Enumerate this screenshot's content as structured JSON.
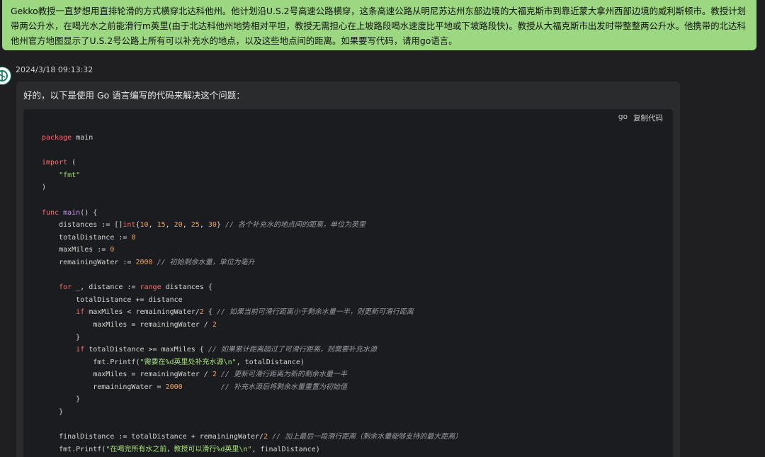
{
  "question": {
    "text": "Gekko教授一直梦想用直排轮滑的方式横穿北达科他州。他计划沿U.S.2号高速公路横穿，这条高速公路从明尼苏达州东部边境的大福克斯市到靠近蒙大拿州西部边境的威利斯顿市。教授计划带两公升水，在喝光水之前能滑行m英里(由于北达科他州地势相对平坦，教授无需担心在上坡路段喝水速度比平地或下坡路段快)。教授从大福克斯市出发时带整整两公升水。他携带的北达科他州官方地图显示了U.S.2号公路上所有可以补充水的地点，以及这些地点间的距离。如果要写代码，请用go语言。"
  },
  "answer": {
    "timestamp": "2024/3/18 09:13:32",
    "intro": "好的，以下是使用 Go 语言编写的代码来解决这个问题：",
    "code_lang": "go",
    "copy_label": "复制代码"
  },
  "code_lines": [
    [
      {
        "t": "package",
        "c": "kw"
      },
      {
        "t": " main",
        "c": "txt"
      }
    ],
    [],
    [
      {
        "t": "import",
        "c": "kw"
      },
      {
        "t": " (",
        "c": "txt"
      }
    ],
    [
      {
        "t": "    ",
        "c": "txt"
      },
      {
        "t": "\"fmt\"",
        "c": "str"
      }
    ],
    [
      {
        "t": ")",
        "c": "txt"
      }
    ],
    [],
    [
      {
        "t": "func",
        "c": "kw"
      },
      {
        "t": " ",
        "c": "txt"
      },
      {
        "t": "main",
        "c": "fn"
      },
      {
        "t": "() {",
        "c": "txt"
      }
    ],
    [
      {
        "t": "    distances := []",
        "c": "txt"
      },
      {
        "t": "int",
        "c": "kw"
      },
      {
        "t": "{",
        "c": "txt"
      },
      {
        "t": "10",
        "c": "num"
      },
      {
        "t": ", ",
        "c": "txt"
      },
      {
        "t": "15",
        "c": "num"
      },
      {
        "t": ", ",
        "c": "txt"
      },
      {
        "t": "20",
        "c": "num"
      },
      {
        "t": ", ",
        "c": "txt"
      },
      {
        "t": "25",
        "c": "num"
      },
      {
        "t": ", ",
        "c": "txt"
      },
      {
        "t": "30",
        "c": "num"
      },
      {
        "t": "} ",
        "c": "txt"
      },
      {
        "t": "// 各个补充水的地点间的距离，单位为英里",
        "c": "cmt"
      }
    ],
    [
      {
        "t": "    totalDistance := ",
        "c": "txt"
      },
      {
        "t": "0",
        "c": "num"
      }
    ],
    [
      {
        "t": "    maxMiles := ",
        "c": "txt"
      },
      {
        "t": "0",
        "c": "num"
      }
    ],
    [
      {
        "t": "    remainingWater := ",
        "c": "txt"
      },
      {
        "t": "2000",
        "c": "num"
      },
      {
        "t": " ",
        "c": "txt"
      },
      {
        "t": "// 初始剩余水量，单位为毫升",
        "c": "cmt"
      }
    ],
    [],
    [
      {
        "t": "    ",
        "c": "txt"
      },
      {
        "t": "for",
        "c": "kw"
      },
      {
        "t": " _, distance := ",
        "c": "txt"
      },
      {
        "t": "range",
        "c": "kw"
      },
      {
        "t": " distances {",
        "c": "txt"
      }
    ],
    [
      {
        "t": "        totalDistance += distance",
        "c": "txt"
      }
    ],
    [
      {
        "t": "        ",
        "c": "txt"
      },
      {
        "t": "if",
        "c": "kw"
      },
      {
        "t": " maxMiles < remainingWater/",
        "c": "txt"
      },
      {
        "t": "2",
        "c": "num"
      },
      {
        "t": " { ",
        "c": "txt"
      },
      {
        "t": "// 如果当前可滑行距离小于剩余水量一半，则更新可滑行距离",
        "c": "cmt"
      }
    ],
    [
      {
        "t": "            maxMiles = remainingWater / ",
        "c": "txt"
      },
      {
        "t": "2",
        "c": "num"
      }
    ],
    [
      {
        "t": "        }",
        "c": "txt"
      }
    ],
    [
      {
        "t": "        ",
        "c": "txt"
      },
      {
        "t": "if",
        "c": "kw"
      },
      {
        "t": " totalDistance >= maxMiles { ",
        "c": "txt"
      },
      {
        "t": "// 如果累计距离超过了可滑行距离，则需要补充水源",
        "c": "cmt"
      }
    ],
    [
      {
        "t": "            fmt.Printf(",
        "c": "txt"
      },
      {
        "t": "\"需要在%d英里处补充水源\\n\"",
        "c": "str"
      },
      {
        "t": ", totalDistance)",
        "c": "txt"
      }
    ],
    [
      {
        "t": "            maxMiles = remainingWater / ",
        "c": "txt"
      },
      {
        "t": "2",
        "c": "num"
      },
      {
        "t": " ",
        "c": "txt"
      },
      {
        "t": "// 更新可滑行距离为新的剩余水量一半",
        "c": "cmt"
      }
    ],
    [
      {
        "t": "            remainingWater = ",
        "c": "txt"
      },
      {
        "t": "2000",
        "c": "num"
      },
      {
        "t": "         ",
        "c": "txt"
      },
      {
        "t": "// 补充水源后将剩余水量重置为初始值",
        "c": "cmt"
      }
    ],
    [
      {
        "t": "        }",
        "c": "txt"
      }
    ],
    [
      {
        "t": "    }",
        "c": "txt"
      }
    ],
    [],
    [
      {
        "t": "    finalDistance := totalDistance + remainingWater/",
        "c": "txt"
      },
      {
        "t": "2",
        "c": "num"
      },
      {
        "t": " ",
        "c": "txt"
      },
      {
        "t": "// 加上最后一段滑行距离（剩余水量能够支持的最大距离）",
        "c": "cmt"
      }
    ],
    [
      {
        "t": "    fmt.Printf(",
        "c": "txt"
      },
      {
        "t": "\"在喝完所有水之前，教授可以滑行%d英里\\n\"",
        "c": "str"
      },
      {
        "t": ", finalDistance)",
        "c": "txt"
      }
    ]
  ]
}
